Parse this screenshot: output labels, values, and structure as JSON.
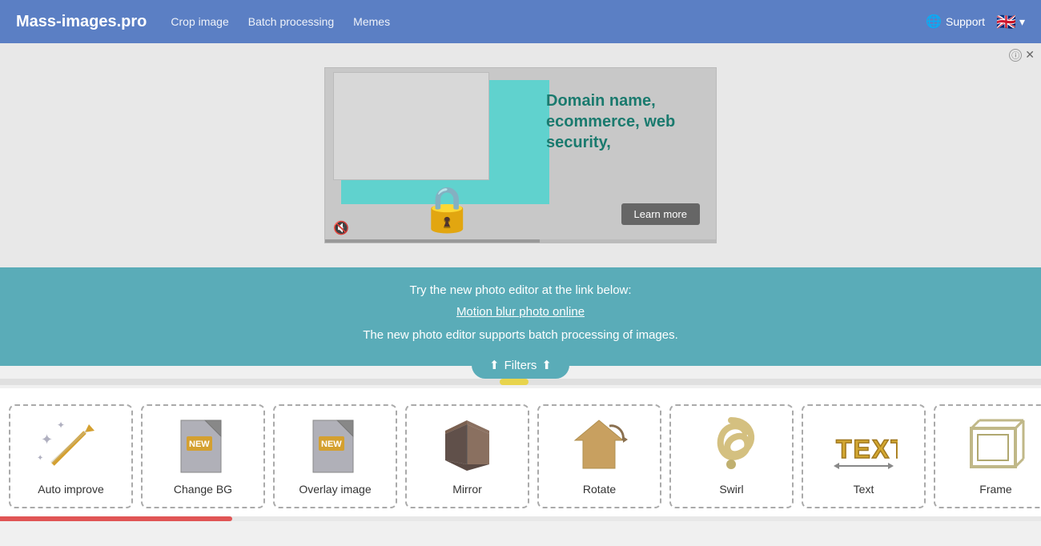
{
  "navbar": {
    "brand": "Mass-images.pro",
    "links": [
      {
        "label": "Crop image",
        "href": "#"
      },
      {
        "label": "Batch processing",
        "href": "#"
      },
      {
        "label": "Memes",
        "href": "#"
      }
    ],
    "support_label": "Support",
    "flag": "🇬🇧",
    "chevron": "▾"
  },
  "ad": {
    "headline": "Domain name, ecommerce, web security,",
    "learn_more": "Learn more",
    "info_icon": "ⓘ",
    "close_icon": "✕"
  },
  "promo": {
    "line1": "Try the new photo editor at the link below:",
    "link_text": "Motion blur photo online",
    "line2": "The new photo editor supports batch processing of images."
  },
  "filters_btn": "⬆ Filters ⬆",
  "tools": [
    {
      "id": "auto-improve",
      "label": "Auto improve",
      "new": false,
      "icon_type": "wand"
    },
    {
      "id": "change-bg",
      "label": "Change BG",
      "new": true,
      "icon_type": "folder"
    },
    {
      "id": "overlay-image",
      "label": "Overlay image",
      "new": true,
      "icon_type": "overlay"
    },
    {
      "id": "mirror",
      "label": "Mirror",
      "new": false,
      "icon_type": "mirror"
    },
    {
      "id": "rotate",
      "label": "Rotate",
      "new": false,
      "icon_type": "rotate"
    },
    {
      "id": "swirl",
      "label": "Swirl",
      "new": false,
      "icon_type": "swirl"
    },
    {
      "id": "text",
      "label": "Text",
      "new": false,
      "icon_type": "text"
    },
    {
      "id": "frame",
      "label": "Frame",
      "new": false,
      "icon_type": "frame"
    }
  ]
}
